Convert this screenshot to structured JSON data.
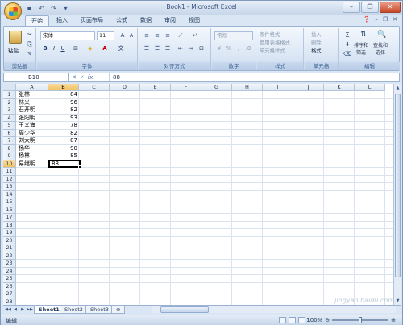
{
  "window": {
    "title": "Book1 - Microsoft Excel",
    "minimize_icon": "minimize-icon",
    "maximize_icon": "restore-icon",
    "close_icon": "close-icon"
  },
  "qat": {
    "save_icon": "save-icon",
    "undo_icon": "undo-icon",
    "redo_icon": "redo-icon"
  },
  "tabs": [
    {
      "label": "开始",
      "active": true
    },
    {
      "label": "插入"
    },
    {
      "label": "页面布局"
    },
    {
      "label": "公式"
    },
    {
      "label": "数据"
    },
    {
      "label": "审阅"
    },
    {
      "label": "视图"
    }
  ],
  "ribbon": {
    "clipboard": {
      "label": "剪贴板",
      "paste": "粘贴"
    },
    "font": {
      "label": "字体",
      "name": "宋体",
      "size": "11",
      "bold": "B",
      "italic": "I",
      "underline": "U"
    },
    "alignment": {
      "label": "对齐方式"
    },
    "number": {
      "label": "数字",
      "format": "常规",
      "percent": "%",
      "comma": ","
    },
    "styles": {
      "label": "样式",
      "conditional": "条件格式",
      "table": "套用表格格式",
      "cell_styles": "单元格样式"
    },
    "cells": {
      "label": "单元格",
      "insert": "插入",
      "delete": "删除",
      "format": "格式"
    },
    "editing": {
      "label": "编辑",
      "sort_filter": "排序和\n筛选",
      "find_select": "查找和\n选择",
      "sum_icon": "Σ"
    }
  },
  "formula_bar": {
    "name_box": "B10",
    "fx": "fx",
    "content": "88"
  },
  "columns": [
    "A",
    "B",
    "C",
    "D",
    "E",
    "F",
    "G",
    "H",
    "I",
    "J",
    "K",
    "L"
  ],
  "rows_count": 30,
  "table": {
    "names": [
      "张林",
      "林义",
      "石开明",
      "张阳明",
      "王义海",
      "周少华",
      "刘大明",
      "杨华",
      "杨林",
      "易继明"
    ],
    "scores": [
      "84",
      "96",
      "82",
      "93",
      "78",
      "82",
      "87",
      "90",
      "85",
      "88"
    ]
  },
  "sheets": [
    "Sheet1",
    "Sheet2",
    "Sheet3"
  ],
  "active_sheet": "Sheet1",
  "status": {
    "mode": "编辑",
    "zoom": "100%"
  },
  "watermark": "jingyan.baidu.com"
}
